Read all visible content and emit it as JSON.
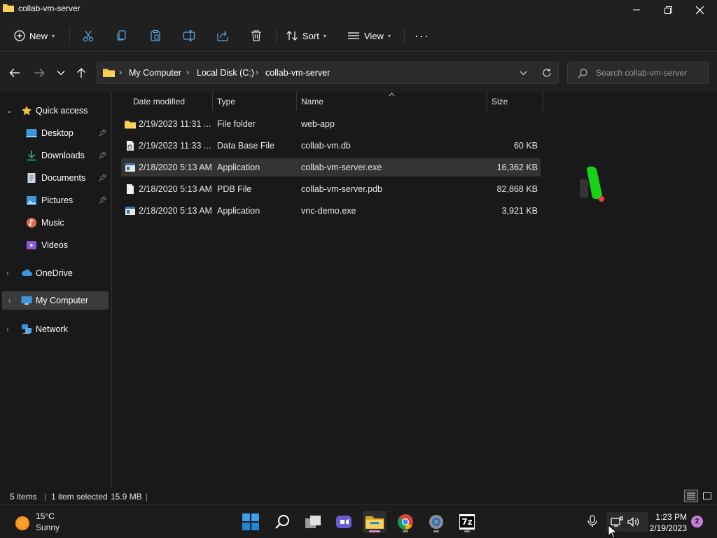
{
  "window": {
    "title": "collab-vm-server"
  },
  "toolbar": {
    "new_label": "New",
    "sort_label": "Sort",
    "view_label": "View",
    "more_label": "···"
  },
  "address": {
    "crumbs": [
      "My Computer",
      "Local Disk (C:)",
      "collab-vm-server"
    ]
  },
  "search": {
    "placeholder": "Search collab-vm-server"
  },
  "nav": {
    "quick_access": "Quick access",
    "desktop": "Desktop",
    "downloads": "Downloads",
    "documents": "Documents",
    "pictures": "Pictures",
    "music": "Music",
    "videos": "Videos",
    "onedrive": "OneDrive",
    "my_computer": "My Computer",
    "network": "Network"
  },
  "columns": {
    "date": "Date modified",
    "type": "Type",
    "name": "Name",
    "size": "Size"
  },
  "files": [
    {
      "date": "2/19/2023 11:31 ...",
      "type": "File folder",
      "name": "web-app",
      "size": "",
      "icon": "folder-icon"
    },
    {
      "date": "2/19/2023 11:33 ...",
      "type": "Data Base File",
      "name": "collab-vm.db",
      "size": "60 KB",
      "icon": "database-file-icon"
    },
    {
      "date": "2/18/2020 5:13 AM",
      "type": "Application",
      "name": "collab-vm-server.exe",
      "size": "16,362 KB",
      "icon": "application-icon"
    },
    {
      "date": "2/18/2020 5:13 AM",
      "type": "PDB File",
      "name": "collab-vm-server.pdb",
      "size": "82,868 KB",
      "icon": "file-icon"
    },
    {
      "date": "2/18/2020 5:13 AM",
      "type": "Application",
      "name": "vnc-demo.exe",
      "size": "3,921 KB",
      "icon": "application-icon"
    }
  ],
  "status": {
    "count": "5 items",
    "selection": "1 item selected",
    "selection_size": "15.9 MB"
  },
  "taskbar": {
    "temperature": "15°C",
    "condition": "Sunny",
    "time": "1:23 PM",
    "date": "2/19/2023",
    "notifications": "2",
    "sevenzip_label": "7z"
  },
  "colors": {
    "folder": "#f3c33f",
    "accent": "#4cc2ff",
    "selected_row": "#333333"
  }
}
